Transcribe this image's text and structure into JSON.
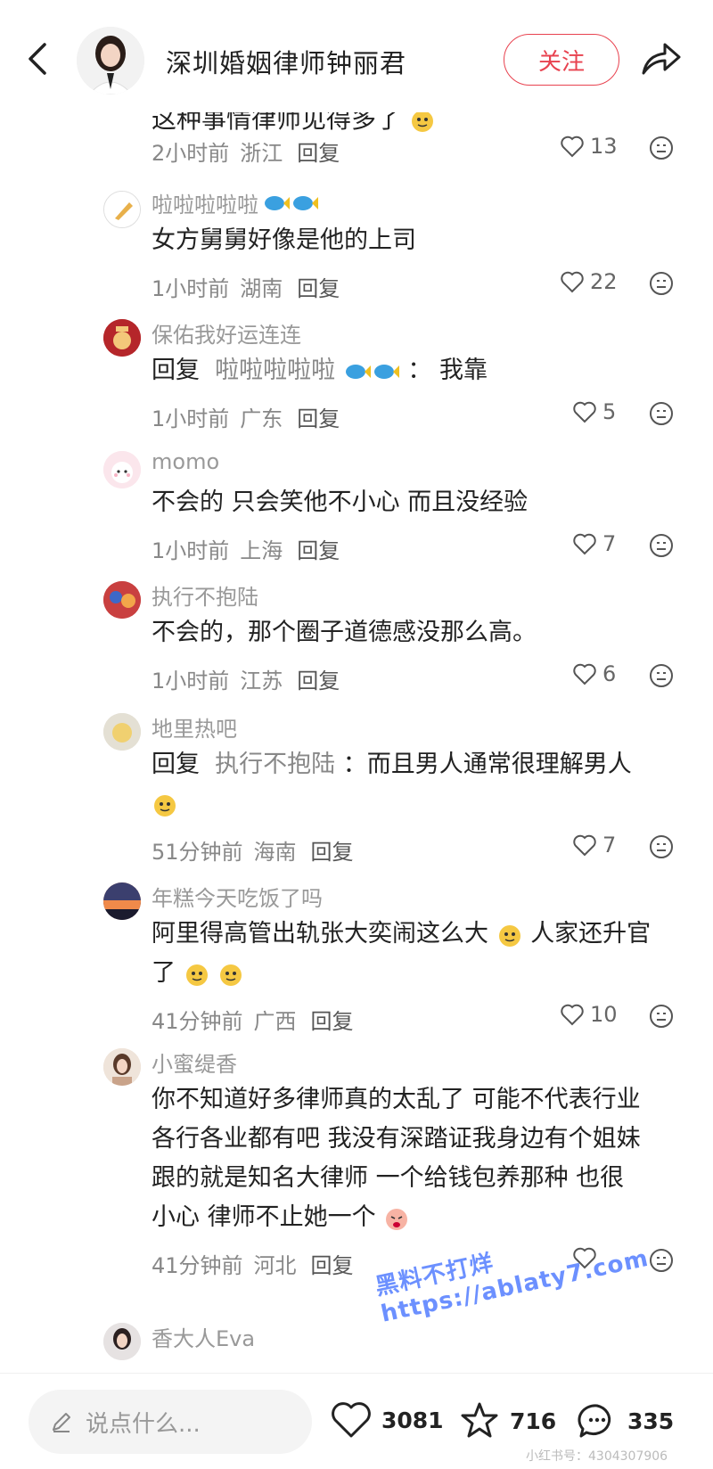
{
  "header": {
    "title": "深圳婚姻律师钟丽君",
    "follow_label": "关注"
  },
  "comments": [
    {
      "partial_text": "这种事情律师见得多了",
      "time": "2小时前",
      "region": "浙江",
      "reply_label": "回复",
      "likes": "13"
    },
    {
      "name": "啦啦啦啦啦",
      "text": "女方舅舅好像是他的上司",
      "time": "1小时前",
      "region": "湖南",
      "reply_label": "回复",
      "likes": "22"
    },
    {
      "name": "保佑我好运连连",
      "reply_prefix": "回复",
      "reply_target": "啦啦啦啦啦",
      "text": "：  我靠",
      "time": "1小时前",
      "region": "广东",
      "reply_label": "回复",
      "likes": "5"
    },
    {
      "name": "momo",
      "text": "不会的 只会笑他不小心 而且没经验",
      "time": "1小时前",
      "region": "上海",
      "reply_label": "回复",
      "likes": "7"
    },
    {
      "name": "执行不抱陆",
      "text": "不会的，那个圈子道德感没那么高。",
      "time": "1小时前",
      "region": "江苏",
      "reply_label": "回复",
      "likes": "6"
    },
    {
      "name": "地里热吧",
      "reply_prefix": "回复",
      "reply_target": "执行不抱陆",
      "text": "：而且男人通常很理解男人",
      "time": "51分钟前",
      "region": "海南",
      "reply_label": "回复",
      "likes": "7"
    },
    {
      "name": "年糕今天吃饭了吗",
      "text_line1": "阿里得高管出轨张大奕闹这么大",
      "text_line1b": "人家还升官",
      "text_line2": "了",
      "time": "41分钟前",
      "region": "广西",
      "reply_label": "回复",
      "likes": "10"
    },
    {
      "name": "小蜜缇香",
      "lines": [
        "你不知道好多律师真的太乱了 可能不代表行业",
        "各行各业都有吧 我没有深踏证我身边有个姐妹",
        "跟的就是知名大律师 一个给钱包养那种 也很",
        "小心 律师不止她一个"
      ],
      "time": "41分钟前",
      "region": "河北",
      "reply_label": "回复",
      "likes": ""
    },
    {
      "name": "香大人Eva"
    }
  ],
  "watermark": "黑料不打烊 https://ablaty7.com",
  "bottom": {
    "input_placeholder": "说点什么...",
    "likes": "3081",
    "favorites": "716",
    "comments": "335"
  },
  "corner_mark": "小红书号：4304307906",
  "colors": {
    "accent": "#e8424f",
    "meta_gray": "#888888",
    "text": "#222222"
  }
}
